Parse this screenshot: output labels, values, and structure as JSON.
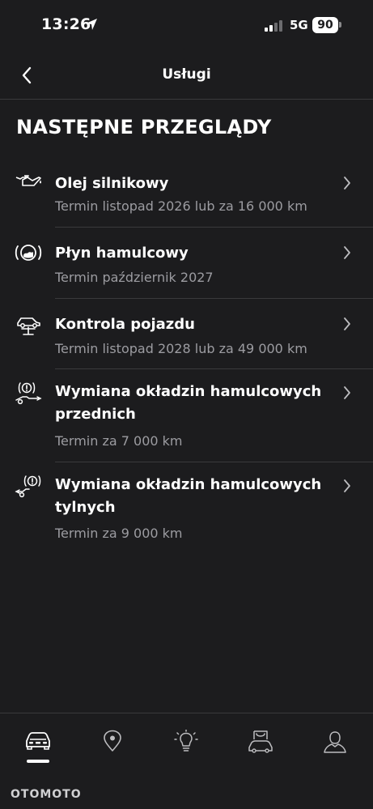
{
  "status_bar": {
    "time": "13:26",
    "network": "5G",
    "battery": "90",
    "icons": [
      "location-arrow-icon",
      "signal-bars-icon"
    ]
  },
  "header": {
    "title": "Usługi",
    "back_icon": "chevron-left-icon"
  },
  "section": {
    "title": "NASTĘPNE PRZEGLĄDY"
  },
  "services": [
    {
      "icon": "engine-oil-icon",
      "title": "Olej silnikowy",
      "subtitle": "Termin listopad 2026 lub za 16 000 km"
    },
    {
      "icon": "brake-fluid-icon",
      "title": "Płyn hamulcowy",
      "subtitle": "Termin październik 2027"
    },
    {
      "icon": "vehicle-lift-icon",
      "title": "Kontrola pojazdu",
      "subtitle": "Termin listopad 2028 lub za 49 000 km"
    },
    {
      "icon": "front-brake-pads-icon",
      "title_line1": "Wymiana okładzin hamulcowych",
      "title_line2": "przednich",
      "subtitle": "Termin za 7 000 km"
    },
    {
      "icon": "rear-brake-pads-icon",
      "title_line1": "Wymiana okładzin hamulcowych",
      "title_line2": "tylnych",
      "subtitle": "Termin za 9 000 km"
    }
  ],
  "tab_bar": {
    "tabs": [
      "car-icon",
      "map-pin-icon",
      "lightbulb-icon",
      "shopping-bag-car-icon",
      "profile-icon"
    ],
    "active": "car-icon"
  },
  "watermark": "OTOMOTO"
}
